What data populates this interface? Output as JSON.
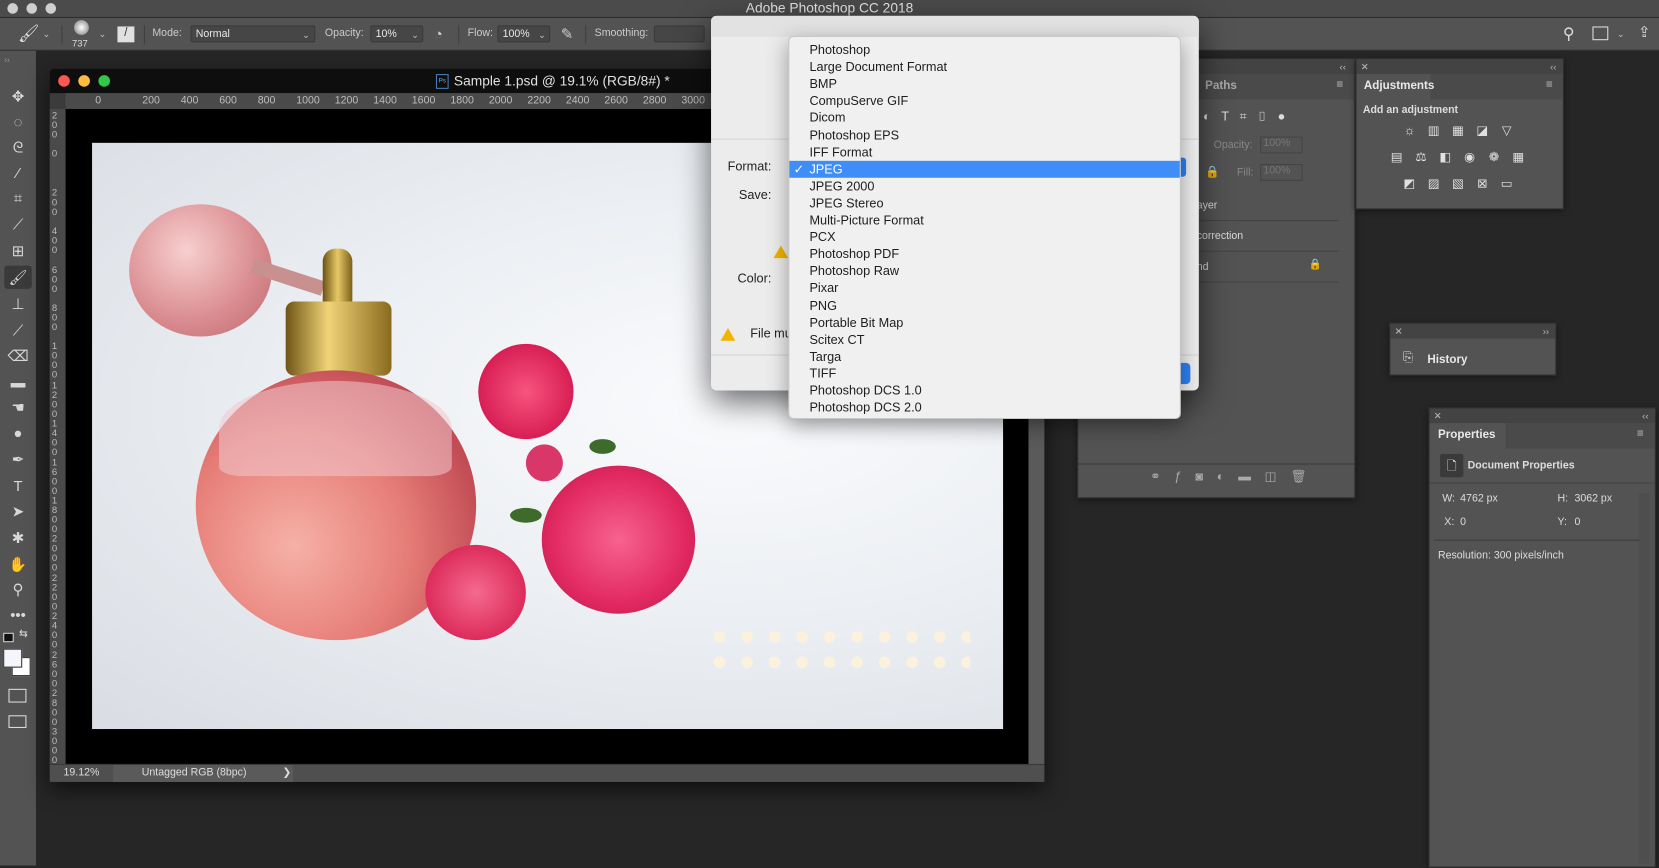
{
  "app": {
    "title": "Adobe Photoshop CC 2018"
  },
  "options_bar": {
    "brush_size": "737",
    "mode_label": "Mode:",
    "mode_value": "Normal",
    "opacity_label": "Opacity:",
    "opacity_value": "10%",
    "flow_label": "Flow:",
    "flow_value": "100%",
    "smoothing_label": "Smoothing:",
    "smoothing_value": ""
  },
  "tools": [
    "move-icon",
    "marquee-icon",
    "lasso-icon",
    "magic-wand-icon",
    "crop-icon",
    "eyedropper-icon",
    "frame-icon",
    "brush-icon",
    "stamp-icon",
    "history-brush-icon",
    "eraser-icon",
    "gradient-icon",
    "smudge-icon",
    "dodge-icon",
    "pen-icon",
    "type-icon",
    "path-select-icon",
    "shape-icon",
    "hand-icon",
    "zoom-icon",
    "more-icon"
  ],
  "tool_glyphs": [
    "✥",
    "◌",
    "ᘓ",
    "⁄",
    "⌗",
    "⟋",
    "⊞",
    "🖌",
    "⊥",
    "⟋",
    "⌫",
    "▬",
    "☚",
    "●",
    "✒",
    "T",
    "➤",
    "✱",
    "✋",
    "⚲",
    "•••"
  ],
  "document": {
    "title": "Sample 1.psd @ 19.1% (RGB/8#) *",
    "ruler_top": [
      "0",
      "200",
      "400",
      "600",
      "800",
      "1000",
      "1200",
      "1400",
      "1600",
      "1800",
      "2000",
      "2200",
      "2400",
      "2600",
      "2800",
      "3000"
    ],
    "ruler_left": [
      "200",
      "0",
      "200",
      "400",
      "600",
      "800",
      "1000",
      "1200",
      "1400",
      "1600",
      "1800",
      "2000",
      "2200",
      "2400",
      "2600",
      "2800",
      "3000"
    ],
    "zoom": "19.12%",
    "color_profile": "Untagged RGB (8bpc)",
    "status_arrow": "❯"
  },
  "dialog": {
    "format_label": "Format:",
    "save_label": "Save:",
    "color_label": "Color:",
    "file_warning": "File mu",
    "format_options": [
      "Photoshop",
      "Large Document Format",
      "BMP",
      "CompuServe GIF",
      "Dicom",
      "Photoshop EPS",
      "IFF Format",
      "JPEG",
      "JPEG 2000",
      "JPEG Stereo",
      "Multi-Picture Format",
      "PCX",
      "Photoshop PDF",
      "Photoshop Raw",
      "Pixar",
      "PNG",
      "Portable Bit Map",
      "Scitex CT",
      "Targa",
      "TIFF",
      "Photoshop DCS 1.0",
      "Photoshop DCS 2.0"
    ],
    "selected_format": "JPEG",
    "check": "✓"
  },
  "layers_panel": {
    "tab": "Paths",
    "opacity_label": "Opacity:",
    "opacity_value": "100%",
    "fill_label": "Fill:",
    "fill_value": "100%",
    "rows": [
      "ayer",
      "correction",
      "nd"
    ]
  },
  "adjustments_panel": {
    "tab": "Adjustments",
    "subtitle": "Add an adjustment",
    "icons_row1": [
      "☼",
      "▥",
      "▦",
      "◪",
      "▽"
    ],
    "icons_row2": [
      "▤",
      "⚖",
      "◧",
      "◉",
      "❁",
      "▦"
    ],
    "icons_row3": [
      "◩",
      "▨",
      "▧",
      "⊠",
      "▭"
    ]
  },
  "history_panel": {
    "title": "History"
  },
  "properties_panel": {
    "tab": "Properties",
    "section": "Document Properties",
    "w_label": "W:",
    "w_value": "4762 px",
    "h_label": "H:",
    "h_value": "3062 px",
    "x_label": "X:",
    "x_value": "0",
    "y_label": "Y:",
    "y_value": "0",
    "resolution": "Resolution: 300 pixels/inch"
  },
  "colors": {
    "accent": "#3f8ef7",
    "panel": "#535353",
    "background": "#262626"
  }
}
